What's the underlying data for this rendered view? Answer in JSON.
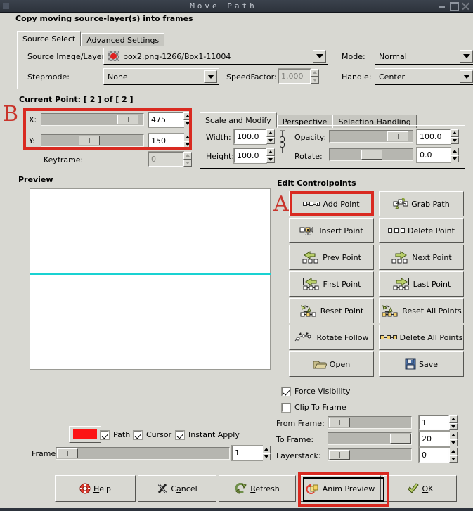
{
  "window": {
    "title": "Move Path",
    "controls": [
      "minimize-icon",
      "maximize-icon",
      "close-icon"
    ]
  },
  "header": {
    "subtitle": "Copy moving source-layer(s) into frames"
  },
  "top_tabs": [
    {
      "label": "Source Select",
      "active": true
    },
    {
      "label": "Advanced Settings",
      "active": false
    }
  ],
  "source_panel": {
    "source_label": "Source Image/Layer:",
    "source_value": "box2.png-1266/Box1-11004",
    "source_thumb_icon": "layer-thumbnail-icon",
    "mode_label": "Mode:",
    "mode_value": "Normal",
    "stepmode_label": "Stepmode:",
    "stepmode_value": "None",
    "speedfactor_label": "SpeedFactor:",
    "speedfactor_value": "1.000",
    "speedfactor_disabled": true,
    "handle_label": "Handle:",
    "handle_value": "Center"
  },
  "current_point": {
    "heading": "Current Point: [   2 ] of [   2 ]",
    "x_label": "X:",
    "x_value": "475",
    "y_label": "Y:",
    "y_value": "150",
    "keyframe_label": "Keyframe:",
    "keyframe_value": "0",
    "keyframe_disabled": true
  },
  "modify_tabs": [
    {
      "label": "Scale and Modify",
      "active": true
    },
    {
      "label": "Perspective",
      "active": false
    },
    {
      "label": "Selection Handling",
      "active": false
    }
  ],
  "modify_panel": {
    "width_label": "Width:",
    "width_value": "100.0",
    "height_label": "Height:",
    "height_value": "100.0",
    "chain_icon": "chain-link-icon",
    "opacity_label": "Opacity:",
    "opacity_value": "100.0",
    "rotate_label": "Rotate:",
    "rotate_value": "0.0"
  },
  "preview": {
    "heading": "Preview",
    "path_line_color": "#19d2d2"
  },
  "preview_controls": {
    "color_swatch": "#fc1414",
    "path_label": "Path",
    "path_checked": true,
    "cursor_label": "Cursor",
    "cursor_checked": true,
    "instant_apply_label": "Instant Apply",
    "instant_apply_checked": true,
    "frame_label": "Frame:",
    "frame_value": "1"
  },
  "edit_controlpoints": {
    "heading": "Edit Controlpoints",
    "buttons": [
      {
        "label": "Add Point",
        "icon": "add-point-icon"
      },
      {
        "label": "Grab Path",
        "icon": "grab-path-icon"
      },
      {
        "label": "Insert Point",
        "icon": "insert-point-icon"
      },
      {
        "label": "Delete Point",
        "icon": "delete-point-icon"
      },
      {
        "label": "Prev Point",
        "icon": "prev-point-icon"
      },
      {
        "label": "Next Point",
        "icon": "next-point-icon"
      },
      {
        "label": "First Point",
        "icon": "first-point-icon"
      },
      {
        "label": "Last Point",
        "icon": "last-point-icon"
      },
      {
        "label": "Reset Point",
        "icon": "reset-point-icon"
      },
      {
        "label": "Reset All Points",
        "icon": "reset-all-points-icon"
      },
      {
        "label": "Rotate Follow",
        "icon": "rotate-follow-icon"
      },
      {
        "label": "Delete All Points",
        "icon": "delete-all-points-icon"
      },
      {
        "label": "Open",
        "icon": "folder-open-icon"
      },
      {
        "label": "Save",
        "icon": "floppy-save-icon"
      }
    ]
  },
  "visibility": {
    "force_visibility_label": "Force Visibility",
    "force_visibility_checked": true,
    "clip_to_frame_label": "Clip To Frame",
    "clip_to_frame_checked": false,
    "from_frame_label": "From Frame:",
    "from_frame_value": "1",
    "to_frame_label": "To Frame:",
    "to_frame_value": "20",
    "layerstack_label": "Layerstack:",
    "layerstack_value": "0"
  },
  "action_bar": [
    {
      "label": "Help",
      "icon": "help-lifering-icon"
    },
    {
      "label": "Cancel",
      "icon": "cancel-x-icon"
    },
    {
      "label": "Refresh",
      "icon": "refresh-arrows-icon"
    },
    {
      "label": "Anim Preview",
      "icon": "anim-preview-icon"
    },
    {
      "label": "OK",
      "icon": "ok-check-icon"
    }
  ],
  "annotations": [
    {
      "letter": "A",
      "target": "add-point-button"
    },
    {
      "letter": "B",
      "target": "current-point-xy-group"
    }
  ],
  "colors": {
    "annotation_red": "#d92a21",
    "letter_red": "#c9342b",
    "window_bg": "#d8d8d2",
    "titlebar": "#343b45"
  }
}
